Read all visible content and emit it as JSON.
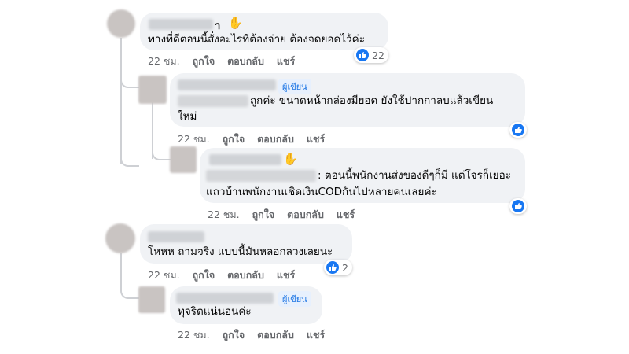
{
  "comments": [
    {
      "name_tail": "า",
      "text": "ทางที่ดีตอนนี้สั่งอะไรที่ต้องจ่าย ต้องจดยอดไว้ค่ะ",
      "time": "22 ชม.",
      "like": "ถูกใจ",
      "reply": "ตอบกลับ",
      "share": "แชร์",
      "reaction_count": "22",
      "icon": "wave-hand-icon"
    },
    {
      "author_badge": "ผู้เขียน",
      "text_line1": "ถูกค่ะ ขนาดหน้ากล่องมียอด ยังใช้ปากกาลบแล้วเขียน",
      "text_line2": "ใหม่",
      "time": "22 ชม.",
      "like": "ถูกใจ",
      "reply": "ตอบกลับ",
      "share": "แชร์"
    },
    {
      "text_line1": ": ตอนนี้พนักงานส่งของดีๆก็มี แต่โจรก็เยอะ",
      "text_line2": "แถวบ้านพนักงานเชิดเงินCODกันไปหลายคนเลยค่ะ",
      "time": "22 ชม.",
      "like": "ถูกใจ",
      "reply": "ตอบกลับ",
      "share": "แชร์",
      "icon": "wave-hand-icon"
    },
    {
      "text": "โหหห ถามจริง แบบนี้มันหลอกลวงเลยนะ",
      "time": "22 ชม.",
      "like": "ถูกใจ",
      "reply": "ตอบกลับ",
      "share": "แชร์",
      "reaction_count": "2"
    },
    {
      "author_badge": "ผู้เขียน",
      "text": "ทุจริตแน่นอนค่ะ",
      "time": "22 ชม.",
      "like": "ถูกใจ",
      "reply": "ตอบกลับ",
      "share": "แชร์"
    }
  ],
  "colors": {
    "bubble": "#f0f2f5",
    "like_blue": "#1877f2",
    "badge_text": "#1b74e4",
    "meta_gray": "#65676b"
  }
}
